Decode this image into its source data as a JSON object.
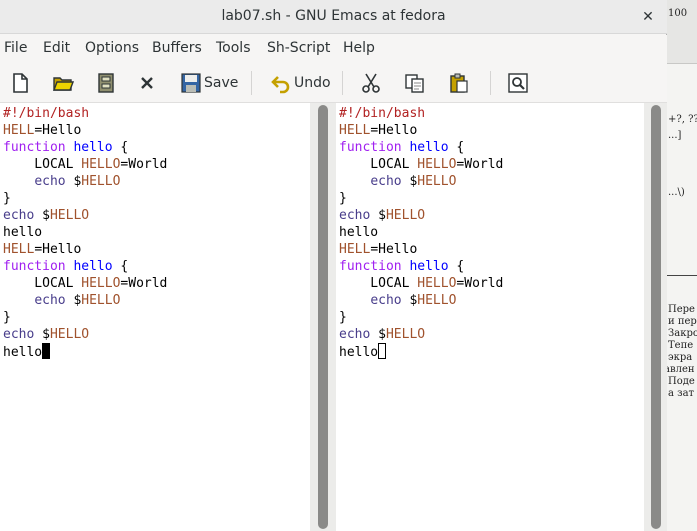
{
  "window": {
    "title": "lab07.sh - GNU Emacs at fedora",
    "close_glyph": "✕"
  },
  "menu": [
    "File",
    "Edit",
    "Options",
    "Buffers",
    "Tools",
    "Sh-Script",
    "Help"
  ],
  "toolbar": {
    "save_label": "Save",
    "undo_label": "Undo"
  },
  "code": [
    [
      {
        "t": "#!/bin/bash",
        "c": "comment"
      }
    ],
    [
      {
        "t": "HELL",
        "c": "var"
      },
      {
        "t": "=Hello",
        "c": "plain"
      }
    ],
    [
      {
        "t": "function",
        "c": "kw"
      },
      {
        "t": " ",
        "c": "plain"
      },
      {
        "t": "hello",
        "c": "fn"
      },
      {
        "t": " {",
        "c": "plain"
      }
    ],
    [
      {
        "t": "    LOCAL ",
        "c": "plain"
      },
      {
        "t": "HELLO",
        "c": "var"
      },
      {
        "t": "=World",
        "c": "plain"
      }
    ],
    [
      {
        "t": "    ",
        "c": "plain"
      },
      {
        "t": "echo",
        "c": "builtin"
      },
      {
        "t": " $",
        "c": "plain"
      },
      {
        "t": "HELLO",
        "c": "var"
      }
    ],
    [
      {
        "t": "}",
        "c": "plain"
      }
    ],
    [
      {
        "t": "echo",
        "c": "builtin"
      },
      {
        "t": " $",
        "c": "plain"
      },
      {
        "t": "HELLO",
        "c": "var"
      }
    ],
    [
      {
        "t": "hello",
        "c": "plain"
      }
    ],
    [
      {
        "t": "HELL",
        "c": "var"
      },
      {
        "t": "=Hello",
        "c": "plain"
      }
    ],
    [
      {
        "t": "function",
        "c": "kw"
      },
      {
        "t": " ",
        "c": "plain"
      },
      {
        "t": "hello",
        "c": "fn"
      },
      {
        "t": " {",
        "c": "plain"
      }
    ],
    [
      {
        "t": "    LOCAL ",
        "c": "plain"
      },
      {
        "t": "HELLO",
        "c": "var"
      },
      {
        "t": "=World",
        "c": "plain"
      }
    ],
    [
      {
        "t": "    ",
        "c": "plain"
      },
      {
        "t": "echo",
        "c": "builtin"
      },
      {
        "t": " $",
        "c": "plain"
      },
      {
        "t": "HELLO",
        "c": "var"
      }
    ],
    [
      {
        "t": "}",
        "c": "plain"
      }
    ],
    [
      {
        "t": "echo",
        "c": "builtin"
      },
      {
        "t": " $",
        "c": "plain"
      },
      {
        "t": "HELLO",
        "c": "var"
      }
    ],
    [
      {
        "t": "hello",
        "c": "plain"
      }
    ]
  ],
  "background_window": {
    "top_text": "100",
    "lines": [
      "+?, ??",
      "...]",
      "...\\)",
      "Пере",
      "и пер",
      "Закро",
      "Тепе",
      "экра",
      "авлен",
      "Поде",
      "а зат"
    ]
  }
}
